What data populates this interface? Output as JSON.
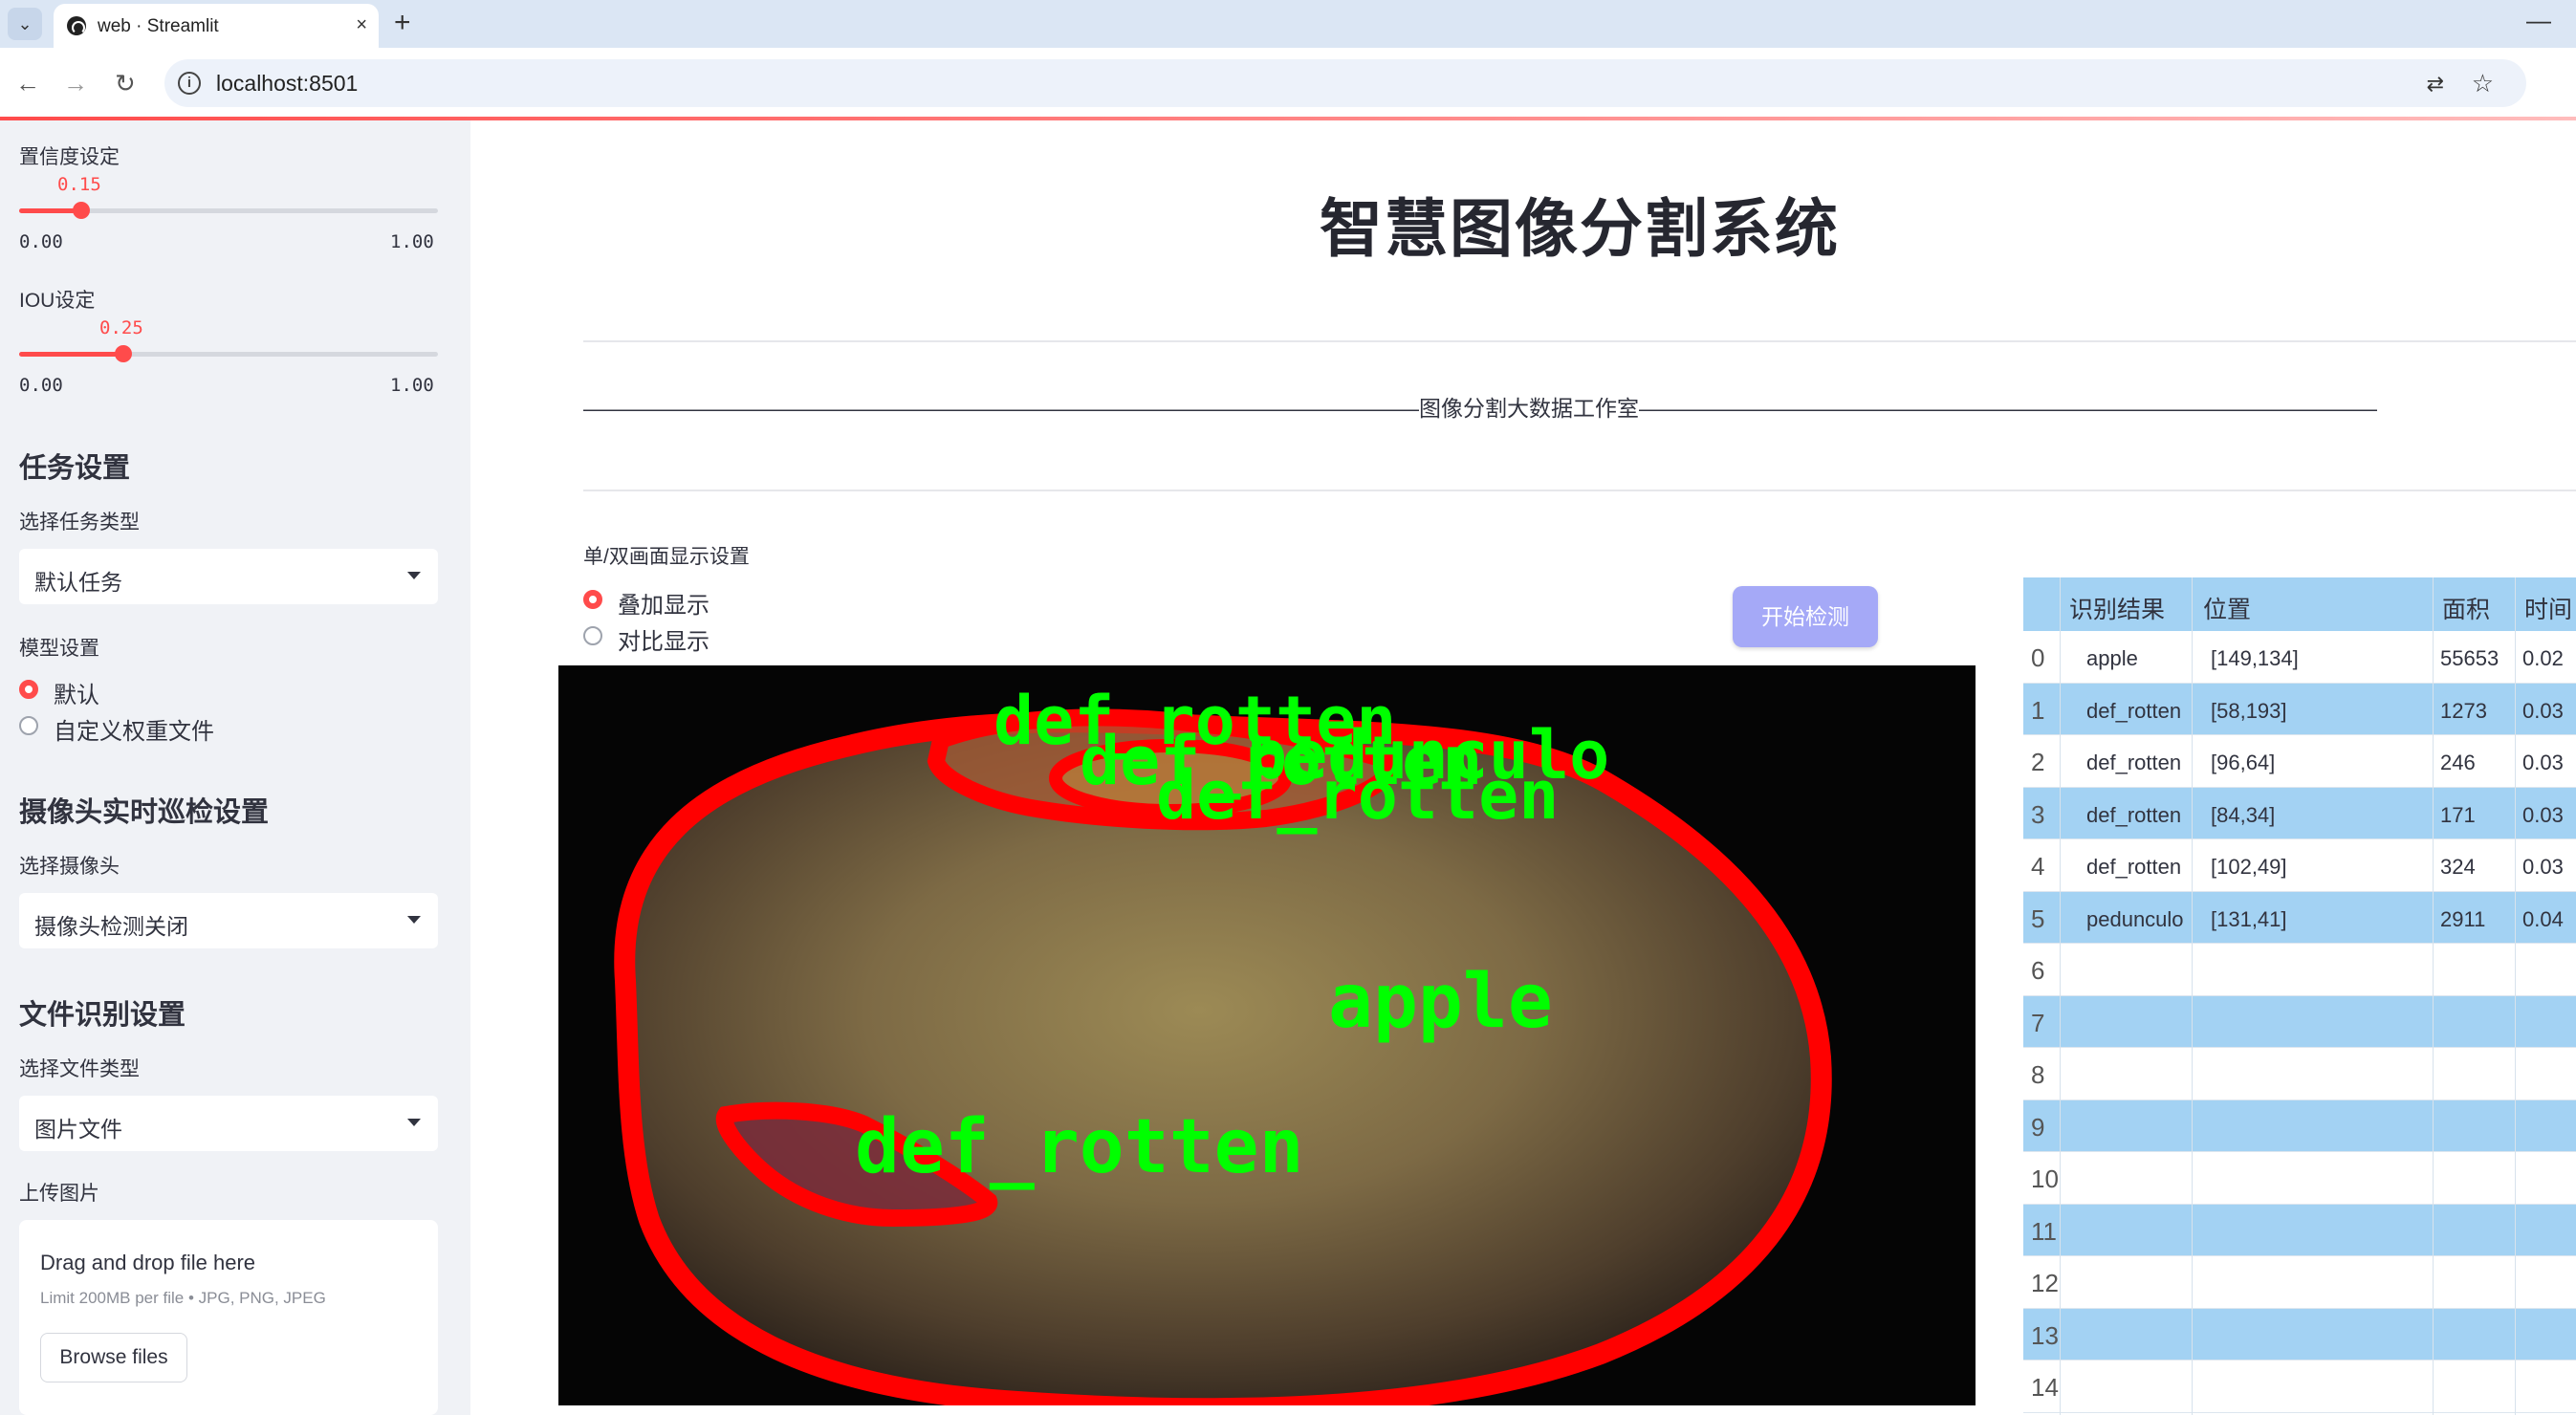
{
  "browser": {
    "tab_title": "web · Streamlit",
    "url": "localhost:8501",
    "new_tab": "+",
    "close": "×",
    "minimize": "—"
  },
  "sidebar": {
    "confidence": {
      "label": "置信度设定",
      "value": "0.15",
      "min": "0.00",
      "max": "1.00",
      "fraction": 0.15
    },
    "iou": {
      "label": "IOU设定",
      "value": "0.25",
      "min": "0.00",
      "max": "1.00",
      "fraction": 0.25
    },
    "task_header": "任务设置",
    "task_type_label": "选择任务类型",
    "task_type_value": "默认任务",
    "model_label": "模型设置",
    "model_options": [
      "默认",
      "自定义权重文件"
    ],
    "model_selected": 0,
    "camera_header": "摄像头实时巡检设置",
    "camera_label": "选择摄像头",
    "camera_value": "摄像头检测关闭",
    "file_header": "文件识别设置",
    "file_type_label": "选择文件类型",
    "file_type_value": "图片文件",
    "upload_label": "上传图片",
    "uploader": {
      "title": "Drag and drop file here",
      "subtitle": "Limit 200MB per file • JPG, PNG, JPEG",
      "button": "Browse files"
    }
  },
  "main": {
    "title": "智慧图像分割系统",
    "studio_line": "——————————————————————————————————————图像分割大数据工作室——————————————————————————————————————",
    "display_label": "单/双画面显示设置",
    "display_options": [
      "叠加显示",
      "对比显示"
    ],
    "display_selected": 0,
    "start_button": "开始检测",
    "image_labels": {
      "top_1": "def_rotten",
      "top_2": "pedunculo",
      "top_3": "def_rotten",
      "top_4": "def_rotten",
      "center": "apple",
      "bottom": "def_rotten"
    }
  },
  "table": {
    "headers": [
      "识别结果",
      "位置",
      "面积",
      "时间"
    ],
    "rows": [
      {
        "idx": "0",
        "label": "apple",
        "pos": "[149,134]",
        "area": "55653",
        "time": "0.02"
      },
      {
        "idx": "1",
        "label": "def_rotten",
        "pos": "[58,193]",
        "area": "1273",
        "time": "0.03"
      },
      {
        "idx": "2",
        "label": "def_rotten",
        "pos": "[96,64]",
        "area": "246",
        "time": "0.03"
      },
      {
        "idx": "3",
        "label": "def_rotten",
        "pos": "[84,34]",
        "area": "171",
        "time": "0.03"
      },
      {
        "idx": "4",
        "label": "def_rotten",
        "pos": "[102,49]",
        "area": "324",
        "time": "0.03"
      },
      {
        "idx": "5",
        "label": "pedunculo",
        "pos": "[131,41]",
        "area": "2911",
        "time": "0.04"
      },
      {
        "idx": "6",
        "label": "",
        "pos": "",
        "area": "",
        "time": ""
      },
      {
        "idx": "7",
        "label": "",
        "pos": "",
        "area": "",
        "time": ""
      },
      {
        "idx": "8",
        "label": "",
        "pos": "",
        "area": "",
        "time": ""
      },
      {
        "idx": "9",
        "label": "",
        "pos": "",
        "area": "",
        "time": ""
      },
      {
        "idx": "10",
        "label": "",
        "pos": "",
        "area": "",
        "time": ""
      },
      {
        "idx": "11",
        "label": "",
        "pos": "",
        "area": "",
        "time": ""
      },
      {
        "idx": "12",
        "label": "",
        "pos": "",
        "area": "",
        "time": ""
      },
      {
        "idx": "13",
        "label": "",
        "pos": "",
        "area": "",
        "time": ""
      },
      {
        "idx": "14",
        "label": "",
        "pos": "",
        "area": "",
        "time": ""
      }
    ]
  },
  "colors": {
    "accent": "#ff4b4b",
    "sidebar_bg": "#f0f2f6",
    "table_stripe": "#a3d2f3",
    "button": "#a5a9f7",
    "mask_outline": "#ff0000",
    "label_text": "#00ff00"
  }
}
